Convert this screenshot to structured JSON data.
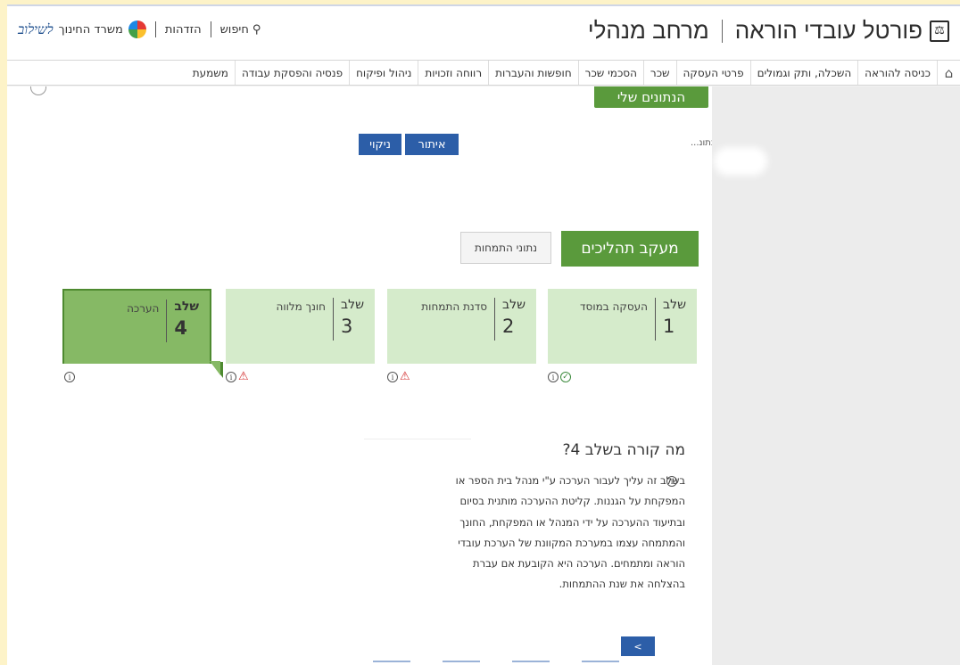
{
  "header": {
    "title": "פורטל עובדי הוראה",
    "subtitle": "מרחב מנהלי",
    "ministry_name": "משרד החינוך",
    "ministry_logo_text": "לשילוב",
    "identify_link": "הזדהות",
    "search_link": "חיפוש"
  },
  "nav": {
    "items": [
      "כניסה להוראה",
      "השכלה, ותק וגמולים",
      "פרטי העסקה",
      "שכר",
      "הסכמי שכר",
      "חופשות והעברות",
      "רווחה וזכויות",
      "ניהול ופיקוח",
      "פנסיה והפסקת עבודה",
      "משמעת"
    ]
  },
  "page": {
    "my_data_label": "הנתונים שלי",
    "filter_label": "נתונ...",
    "filter_button": "איתור",
    "clear_button": "ניקוי",
    "tabs": {
      "process": "מעקב תהליכים",
      "internship_data": "נתוני התמחות"
    },
    "stages": [
      {
        "word": "שלב",
        "number": "1",
        "name": "העסקה במוסד",
        "status": "ok"
      },
      {
        "word": "שלב",
        "number": "2",
        "name": "סדנת התמחות",
        "status": "warning"
      },
      {
        "word": "שלב",
        "number": "3",
        "name": "חונך מלווה",
        "status": "warning"
      },
      {
        "word": "שלב",
        "number": "4",
        "name": "הערכה",
        "status": "active"
      }
    ],
    "question_title": "מה קורה בשלב 4?",
    "description_lines": [
      "בשלב זה עליך לעבור הערכה ע\"י מנהל בית הספר או",
      "המפקחת על הגננות. קליטת ההערכה מותנית בסיום",
      "ובתיעוד ההערכה על ידי המנהל או המפקחת, החונך",
      "והמתמחה עצמו במערכת המקוונת של הערכת עובדי",
      "הוראה ומתמחים. הערכה היא הקובעת אם עברת",
      "בהצלחה את שנת ההתמחות."
    ],
    "pager_label": "<"
  },
  "colors": {
    "accent_green": "#5a9a3c",
    "stage_light": "#d5ebcb",
    "stage_active": "#86b965",
    "button_blue": "#2c5ea8",
    "warning_red": "#d32f2f"
  },
  "icons": [
    "emblem-icon",
    "pinwheel-logo-icon",
    "search-icon",
    "home-icon",
    "info-icon",
    "warning-icon",
    "check-circle-icon"
  ]
}
